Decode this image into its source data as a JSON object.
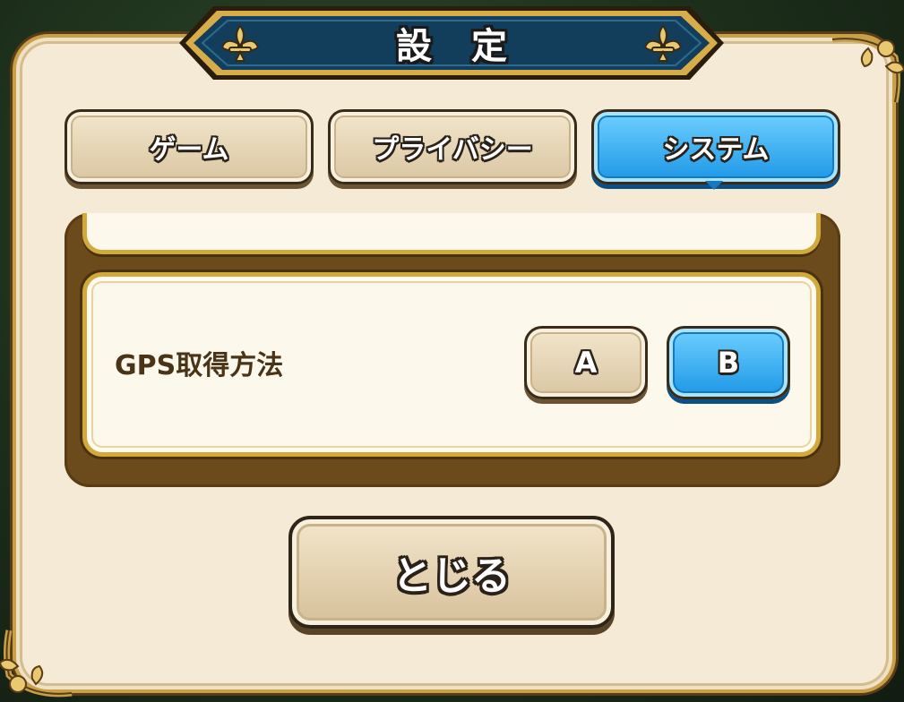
{
  "dialog": {
    "title": "設定"
  },
  "tabs": [
    {
      "label": "ゲーム",
      "selected": false
    },
    {
      "label": "プライバシー",
      "selected": false
    },
    {
      "label": "システム",
      "selected": true
    }
  ],
  "settings": {
    "gps": {
      "label": "GPS取得方法",
      "options": [
        "A",
        "B"
      ],
      "selected": "B"
    }
  },
  "footer": {
    "close_label": "とじる"
  },
  "colors": {
    "selected_blue": "#1c97e6",
    "unselected_beige": "#e6d6b6",
    "banner_navy": "#123e5c",
    "frame_gold": "#d2a93b",
    "list_brown": "#6b4a1c"
  },
  "icons": [
    "fleur-de-lis-icon",
    "corner-ornament-icon"
  ]
}
